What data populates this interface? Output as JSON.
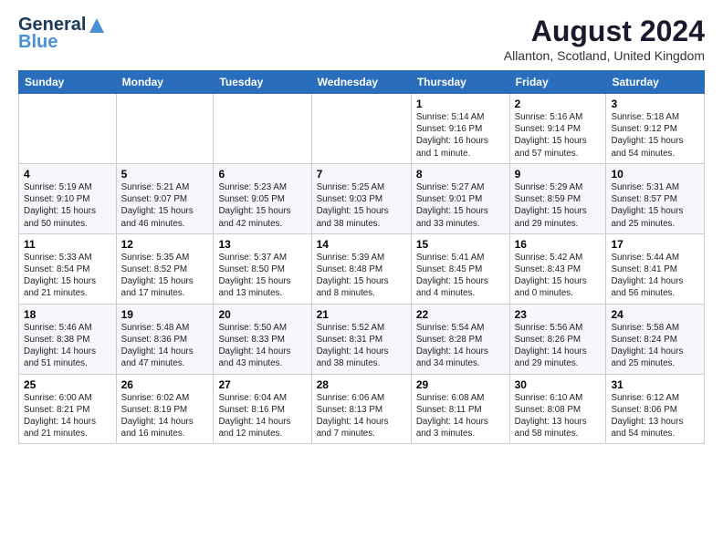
{
  "header": {
    "logo_line1": "General",
    "logo_line2": "Blue",
    "title": "August 2024",
    "subtitle": "Allanton, Scotland, United Kingdom"
  },
  "days_of_week": [
    "Sunday",
    "Monday",
    "Tuesday",
    "Wednesday",
    "Thursday",
    "Friday",
    "Saturday"
  ],
  "weeks": [
    [
      {
        "day": "",
        "info": ""
      },
      {
        "day": "",
        "info": ""
      },
      {
        "day": "",
        "info": ""
      },
      {
        "day": "",
        "info": ""
      },
      {
        "day": "1",
        "info": "Sunrise: 5:14 AM\nSunset: 9:16 PM\nDaylight: 16 hours\nand 1 minute."
      },
      {
        "day": "2",
        "info": "Sunrise: 5:16 AM\nSunset: 9:14 PM\nDaylight: 15 hours\nand 57 minutes."
      },
      {
        "day": "3",
        "info": "Sunrise: 5:18 AM\nSunset: 9:12 PM\nDaylight: 15 hours\nand 54 minutes."
      }
    ],
    [
      {
        "day": "4",
        "info": "Sunrise: 5:19 AM\nSunset: 9:10 PM\nDaylight: 15 hours\nand 50 minutes."
      },
      {
        "day": "5",
        "info": "Sunrise: 5:21 AM\nSunset: 9:07 PM\nDaylight: 15 hours\nand 46 minutes."
      },
      {
        "day": "6",
        "info": "Sunrise: 5:23 AM\nSunset: 9:05 PM\nDaylight: 15 hours\nand 42 minutes."
      },
      {
        "day": "7",
        "info": "Sunrise: 5:25 AM\nSunset: 9:03 PM\nDaylight: 15 hours\nand 38 minutes."
      },
      {
        "day": "8",
        "info": "Sunrise: 5:27 AM\nSunset: 9:01 PM\nDaylight: 15 hours\nand 33 minutes."
      },
      {
        "day": "9",
        "info": "Sunrise: 5:29 AM\nSunset: 8:59 PM\nDaylight: 15 hours\nand 29 minutes."
      },
      {
        "day": "10",
        "info": "Sunrise: 5:31 AM\nSunset: 8:57 PM\nDaylight: 15 hours\nand 25 minutes."
      }
    ],
    [
      {
        "day": "11",
        "info": "Sunrise: 5:33 AM\nSunset: 8:54 PM\nDaylight: 15 hours\nand 21 minutes."
      },
      {
        "day": "12",
        "info": "Sunrise: 5:35 AM\nSunset: 8:52 PM\nDaylight: 15 hours\nand 17 minutes."
      },
      {
        "day": "13",
        "info": "Sunrise: 5:37 AM\nSunset: 8:50 PM\nDaylight: 15 hours\nand 13 minutes."
      },
      {
        "day": "14",
        "info": "Sunrise: 5:39 AM\nSunset: 8:48 PM\nDaylight: 15 hours\nand 8 minutes."
      },
      {
        "day": "15",
        "info": "Sunrise: 5:41 AM\nSunset: 8:45 PM\nDaylight: 15 hours\nand 4 minutes."
      },
      {
        "day": "16",
        "info": "Sunrise: 5:42 AM\nSunset: 8:43 PM\nDaylight: 15 hours\nand 0 minutes."
      },
      {
        "day": "17",
        "info": "Sunrise: 5:44 AM\nSunset: 8:41 PM\nDaylight: 14 hours\nand 56 minutes."
      }
    ],
    [
      {
        "day": "18",
        "info": "Sunrise: 5:46 AM\nSunset: 8:38 PM\nDaylight: 14 hours\nand 51 minutes."
      },
      {
        "day": "19",
        "info": "Sunrise: 5:48 AM\nSunset: 8:36 PM\nDaylight: 14 hours\nand 47 minutes."
      },
      {
        "day": "20",
        "info": "Sunrise: 5:50 AM\nSunset: 8:33 PM\nDaylight: 14 hours\nand 43 minutes."
      },
      {
        "day": "21",
        "info": "Sunrise: 5:52 AM\nSunset: 8:31 PM\nDaylight: 14 hours\nand 38 minutes."
      },
      {
        "day": "22",
        "info": "Sunrise: 5:54 AM\nSunset: 8:28 PM\nDaylight: 14 hours\nand 34 minutes."
      },
      {
        "day": "23",
        "info": "Sunrise: 5:56 AM\nSunset: 8:26 PM\nDaylight: 14 hours\nand 29 minutes."
      },
      {
        "day": "24",
        "info": "Sunrise: 5:58 AM\nSunset: 8:24 PM\nDaylight: 14 hours\nand 25 minutes."
      }
    ],
    [
      {
        "day": "25",
        "info": "Sunrise: 6:00 AM\nSunset: 8:21 PM\nDaylight: 14 hours\nand 21 minutes."
      },
      {
        "day": "26",
        "info": "Sunrise: 6:02 AM\nSunset: 8:19 PM\nDaylight: 14 hours\nand 16 minutes."
      },
      {
        "day": "27",
        "info": "Sunrise: 6:04 AM\nSunset: 8:16 PM\nDaylight: 14 hours\nand 12 minutes."
      },
      {
        "day": "28",
        "info": "Sunrise: 6:06 AM\nSunset: 8:13 PM\nDaylight: 14 hours\nand 7 minutes."
      },
      {
        "day": "29",
        "info": "Sunrise: 6:08 AM\nSunset: 8:11 PM\nDaylight: 14 hours\nand 3 minutes."
      },
      {
        "day": "30",
        "info": "Sunrise: 6:10 AM\nSunset: 8:08 PM\nDaylight: 13 hours\nand 58 minutes."
      },
      {
        "day": "31",
        "info": "Sunrise: 6:12 AM\nSunset: 8:06 PM\nDaylight: 13 hours\nand 54 minutes."
      }
    ]
  ]
}
